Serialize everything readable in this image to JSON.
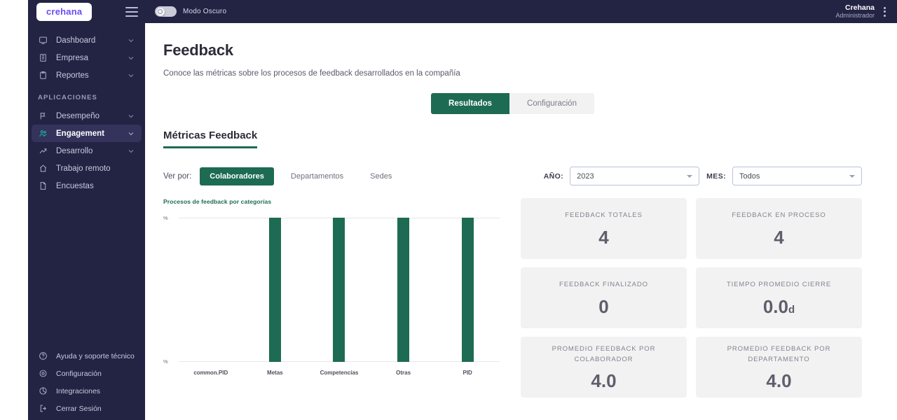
{
  "brand": {
    "logo_text": "crehana",
    "accent": "#6b4df6"
  },
  "theme": {
    "green": "#1d6b52",
    "sidebar_bg": "#232344",
    "card_bg": "#f2f2f2"
  },
  "topbar": {
    "dark_mode_label": "Modo Oscuro",
    "user_name": "Crehana",
    "user_role": "Administrador"
  },
  "sidebar": {
    "items": [
      {
        "label": "Dashboard",
        "icon": "dashboard-icon",
        "expandable": true
      },
      {
        "label": "Empresa",
        "icon": "building-icon",
        "expandable": true
      },
      {
        "label": "Reportes",
        "icon": "clipboard-icon",
        "expandable": true
      }
    ],
    "section_label": "APLICACIONES",
    "apps": [
      {
        "label": "Desempeño",
        "icon": "flag-icon",
        "expandable": true,
        "active": false
      },
      {
        "label": "Engagement",
        "icon": "people-icon",
        "expandable": true,
        "active": true
      },
      {
        "label": "Desarrollo",
        "icon": "growth-arrow-icon",
        "expandable": true,
        "active": false
      },
      {
        "label": "Trabajo remoto",
        "icon": "home-icon",
        "expandable": false,
        "active": false
      },
      {
        "label": "Encuestas",
        "icon": "document-icon",
        "expandable": false,
        "active": false
      }
    ],
    "bottom": [
      {
        "label": "Ayuda y soporte técnico",
        "icon": "help-circle-icon"
      },
      {
        "label": "Configuración",
        "icon": "gear-icon"
      },
      {
        "label": "Integraciones",
        "icon": "integrations-icon"
      },
      {
        "label": "Cerrar Sesión",
        "icon": "logout-icon"
      }
    ]
  },
  "main": {
    "title": "Feedback",
    "subtitle": "Conoce las métricas sobre los procesos de feedback desarrollados en la compañía",
    "tabs": [
      {
        "label": "Resultados",
        "active": true
      },
      {
        "label": "Configuración",
        "active": false
      }
    ],
    "section_title": "Métricas Feedback",
    "view_by_label": "Ver por:",
    "view_by_options": [
      {
        "label": "Colaboradores",
        "active": true
      },
      {
        "label": "Departamentos",
        "active": false
      },
      {
        "label": "Sedes",
        "active": false
      }
    ],
    "filters": [
      {
        "label": "AÑO:",
        "value": "2023"
      },
      {
        "label": "MES:",
        "value": "Todos"
      }
    ],
    "cards": [
      {
        "label": "FEEDBACK TOTALES",
        "value": "4",
        "suffix": ""
      },
      {
        "label": "FEEDBACK EN PROCESO",
        "value": "4",
        "suffix": ""
      },
      {
        "label": "FEEDBACK FINALIZADO",
        "value": "0",
        "suffix": ""
      },
      {
        "label": "TIEMPO PROMEDIO CIERRE",
        "value": "0.0",
        "suffix": "d"
      },
      {
        "label": "PROMEDIO FEEDBACK POR COLABORADOR",
        "value": "4.0",
        "suffix": ""
      },
      {
        "label": "PROMEDIO FEEDBACK POR DEPARTAMENTO",
        "value": "4.0",
        "suffix": ""
      }
    ]
  },
  "chart_data": {
    "type": "bar",
    "title": "Procesos de feedback por categorías",
    "categories": [
      "common.PID",
      "Metas",
      "Competencias",
      "Otras",
      "PID"
    ],
    "values": [
      0,
      100,
      100,
      100,
      100
    ],
    "xlabel": "",
    "ylabel": "%",
    "ytick_top": "%",
    "ytick_bottom": "%",
    "ylim": [
      0,
      100
    ],
    "grid": true,
    "legend": "none",
    "bar_color": "#1d6b52"
  }
}
